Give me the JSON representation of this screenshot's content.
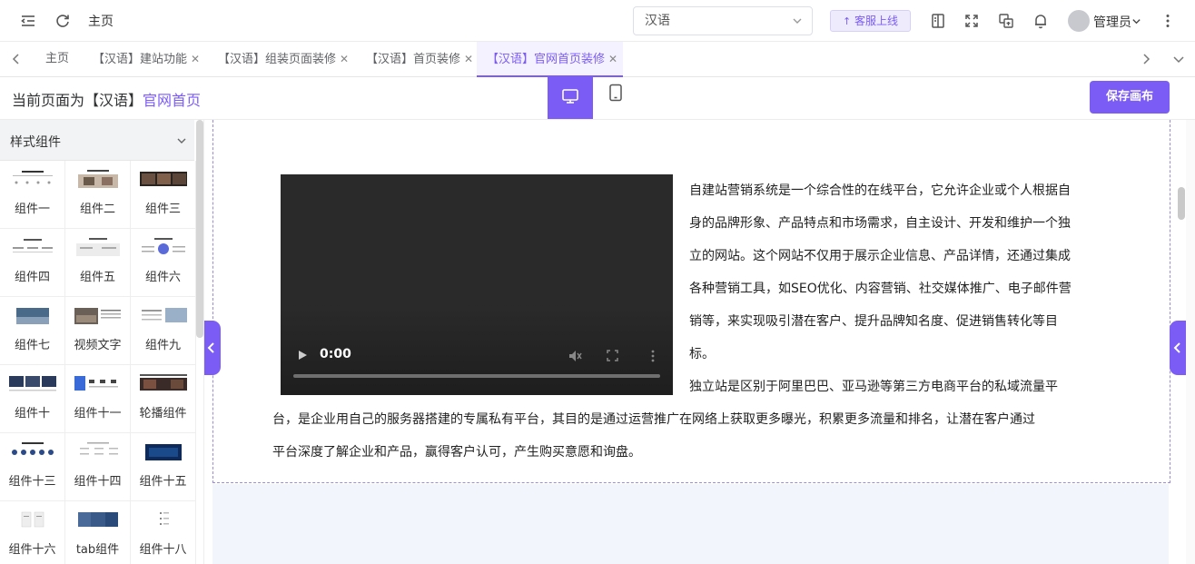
{
  "topbar": {
    "home_label": "主页",
    "language_select": {
      "value": "汉语"
    },
    "customer_service_label": "客服上线",
    "user_name": "管理员"
  },
  "tabs": [
    {
      "label": "主页"
    },
    {
      "label": "【汉语】建站功能"
    },
    {
      "label": "【汉语】组装页面装修"
    },
    {
      "label": "【汉语】首页装修"
    },
    {
      "label": "【汉语】官网首页装修"
    }
  ],
  "editor": {
    "current_page_prefix": "当前页面为【汉语】",
    "current_page_name": "官网首页",
    "save_label": "保存画布"
  },
  "left_panel": {
    "header": "样式组件",
    "components": [
      {
        "label": "组件一"
      },
      {
        "label": "组件二"
      },
      {
        "label": "组件三"
      },
      {
        "label": "组件四"
      },
      {
        "label": "组件五"
      },
      {
        "label": "组件六"
      },
      {
        "label": "组件七"
      },
      {
        "label": "视频文字"
      },
      {
        "label": "组件九"
      },
      {
        "label": "组件十"
      },
      {
        "label": "组件十一"
      },
      {
        "label": "轮播组件"
      },
      {
        "label": "组件十三"
      },
      {
        "label": "组件十四"
      },
      {
        "label": "组件十五"
      },
      {
        "label": "组件十六"
      },
      {
        "label": "tab组件"
      },
      {
        "label": "组件十八"
      }
    ]
  },
  "canvas": {
    "video": {
      "time": "0:00"
    },
    "paragraph1_lines": [
      "自建站营销系统是一个综合性的在线平台，它允许企业或个人根据自",
      "身的品牌形象、产品特点和市场需求，自主设计、开发和维护一个独",
      "立的网站。这个网站不仅用于展示企业信息、产品详情，还通过集成",
      "各种营销工具，如SEO优化、内容营销、社交媒体推广、电子邮件营",
      "销等，来实现吸引潜在客户、提升品牌知名度、促进销售转化等目",
      "标。"
    ],
    "paragraph2_lines": [
      "独立站是区别于阿里巴巴、亚马逊等第三方电商平台的私域流量平",
      "台，是企业用自己的服务器搭建的专属私有平台，其目的是通过运营推广在网络上获取更多曝光，积累更多流量和排名，让潜在客户通过",
      "平台深度了解企业和产品，赢得客户认可，产生购买意愿和询盘。"
    ]
  }
}
